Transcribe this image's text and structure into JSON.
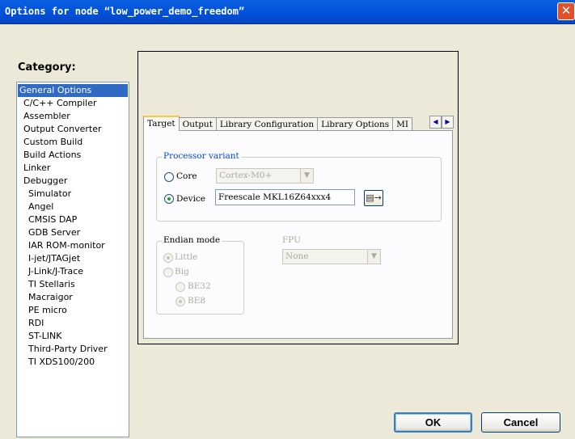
{
  "window": {
    "title": "Options for node “low_power_demo_freedom”",
    "close_glyph": "✕"
  },
  "category": {
    "label": "Category:",
    "items": [
      {
        "label": "General Options",
        "selected": true
      },
      {
        "label": "C/C++ Compiler"
      },
      {
        "label": "Assembler"
      },
      {
        "label": "Output Converter"
      },
      {
        "label": "Custom Build"
      },
      {
        "label": "Build Actions"
      },
      {
        "label": "Linker"
      },
      {
        "label": "Debugger"
      },
      {
        "label": "Simulator"
      },
      {
        "label": "Angel"
      },
      {
        "label": "CMSIS DAP"
      },
      {
        "label": "GDB Server"
      },
      {
        "label": "IAR ROM-monitor"
      },
      {
        "label": "I-jet/JTAGjet"
      },
      {
        "label": "J-Link/J-Trace"
      },
      {
        "label": "TI Stellaris"
      },
      {
        "label": "Macraigor"
      },
      {
        "label": "PE micro"
      },
      {
        "label": "RDI"
      },
      {
        "label": "ST-LINK"
      },
      {
        "label": "Third-Party Driver"
      },
      {
        "label": "TI XDS100/200"
      }
    ]
  },
  "tabs": {
    "items": [
      "Target",
      "Output",
      "Library Configuration",
      "Library Options",
      "MI"
    ],
    "active": "Target",
    "scroll_left": "◀",
    "scroll_right": "▶"
  },
  "processor_variant": {
    "title": "Processor variant",
    "core_label": "Core",
    "core_value": "Cortex-M0+",
    "device_label": "Device",
    "device_value": "Freescale MKL16Z64xxx4",
    "selected": "Device",
    "device_button_icon": "device-select-icon"
  },
  "endian_mode": {
    "title": "Endian mode",
    "little_label": "Little",
    "big_label": "Big",
    "be32_label": "BE32",
    "be8_label": "BE8",
    "selected": "Little",
    "sub_selected": "BE8"
  },
  "fpu": {
    "title": "FPU",
    "value": "None"
  },
  "buttons": {
    "ok": "OK",
    "cancel": "Cancel"
  },
  "colors": {
    "titlebar": "#0050d8",
    "selection": "#316ac5",
    "group_title": "#0046d5",
    "radio_dot": "#21a121"
  }
}
